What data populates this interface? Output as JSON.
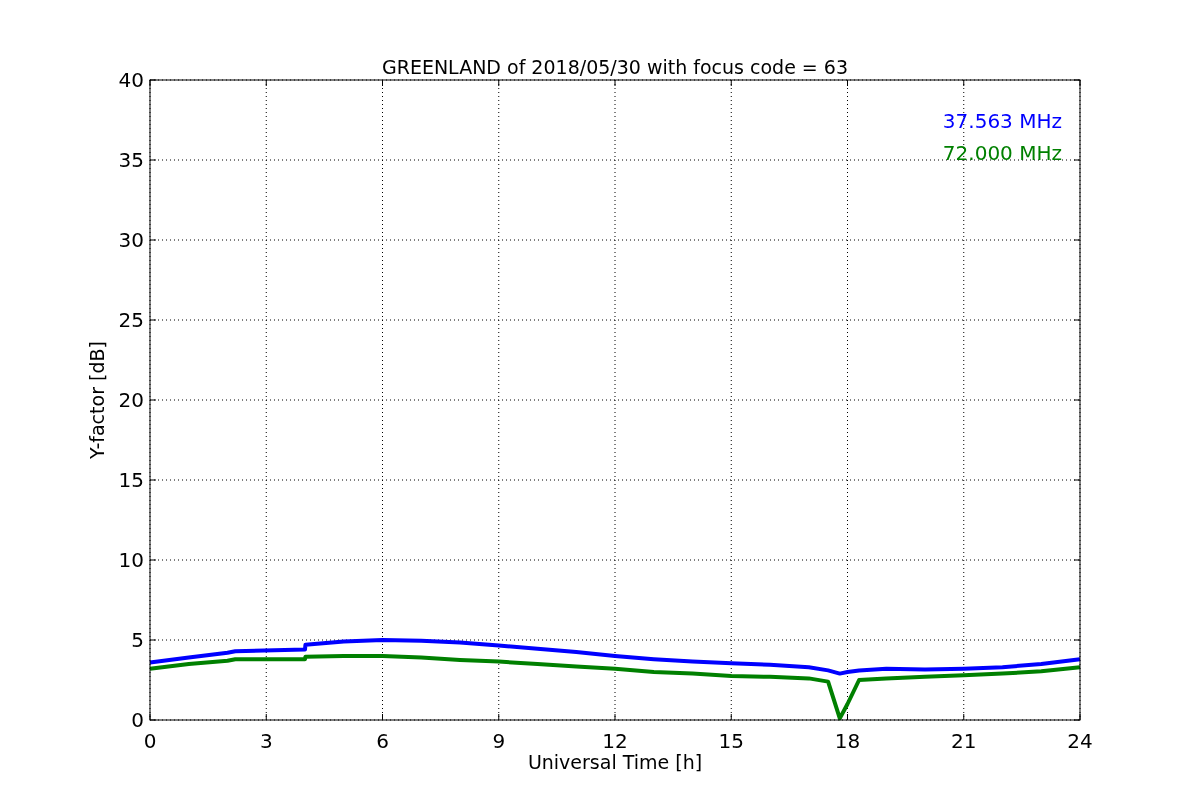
{
  "chart_data": {
    "type": "line",
    "title": "GREENLAND of 2018/05/30 with focus code = 63",
    "xlabel": "Universal Time [h]",
    "ylabel": "Y-factor [dB]",
    "x": [
      0,
      1,
      2,
      2.2,
      4,
      4.01,
      5,
      6,
      7,
      8,
      9,
      10,
      11,
      12,
      13,
      14,
      15,
      16,
      17,
      17.5,
      17.8,
      18,
      18.3,
      19,
      20,
      21,
      22,
      23,
      24
    ],
    "series": [
      {
        "name": "37.563 MHz",
        "color": "#0000ff",
        "values": [
          3.6,
          3.9,
          4.2,
          4.3,
          4.4,
          4.7,
          4.9,
          5.0,
          4.95,
          4.85,
          4.65,
          4.45,
          4.25,
          4.0,
          3.8,
          3.65,
          3.55,
          3.45,
          3.3,
          3.1,
          2.9,
          3.0,
          3.1,
          3.2,
          3.15,
          3.2,
          3.3,
          3.5,
          3.8
        ]
      },
      {
        "name": "72.000 MHz",
        "color": "#008000",
        "values": [
          3.2,
          3.5,
          3.7,
          3.8,
          3.8,
          3.95,
          4.0,
          4.0,
          3.9,
          3.75,
          3.65,
          3.5,
          3.35,
          3.2,
          3.0,
          2.9,
          2.75,
          2.7,
          2.6,
          2.4,
          0.1,
          1.0,
          2.5,
          2.6,
          2.7,
          2.8,
          2.9,
          3.05,
          3.3
        ]
      }
    ],
    "grid": true,
    "xlim": [
      0,
      24
    ],
    "ylim": [
      0,
      40
    ],
    "xticks": [
      0,
      3,
      6,
      9,
      12,
      15,
      18,
      21,
      24
    ],
    "yticks": [
      0,
      5,
      10,
      15,
      20,
      25,
      30,
      35,
      40
    ]
  }
}
